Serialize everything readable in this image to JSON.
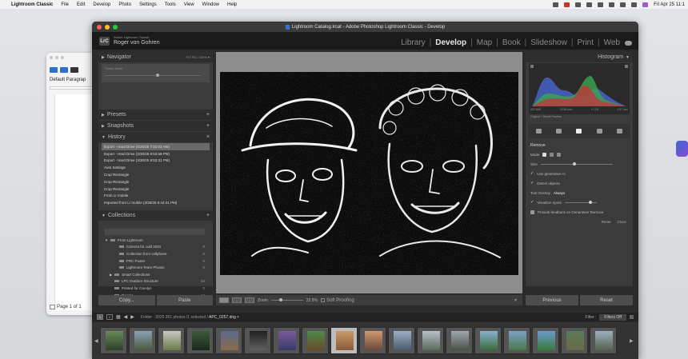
{
  "menubar": {
    "items": [
      "Lightroom Classic",
      "File",
      "Edit",
      "Develop",
      "Photo",
      "Settings",
      "Tools",
      "View",
      "Window",
      "Help"
    ],
    "clock": "Fri Apr 25 11:1"
  },
  "word": {
    "style": "Default Paragrap",
    "status": "Page 1 of 1"
  },
  "lr": {
    "title": "Lightroom Catalog.lrcat - Adobe Photoshop Lightroom Classic - Develop",
    "brand": "Adobe Lightroom Classic",
    "user": "Roger von Gohren",
    "modules": [
      "Library",
      "Develop",
      "Map",
      "Book",
      "Slideshow",
      "Print",
      "Web"
    ],
    "active_module": "Develop",
    "left": {
      "navigator": "Navigator",
      "nav_zoom": "FIT  FILL  100%  ▾",
      "nav_preset": "Preset  None",
      "presets": "Presets",
      "snapshots": "Snapshots",
      "history": "History",
      "history_items": [
        "Export - Hard Drive (4/25/25 7:52:03 AM)",
        "Export - Hard Drive (3/30/25 8:53:58 PM)",
        "Export - Hard Drive (3/30/25 8:53:31 PM)",
        "Auto Settings",
        "Crop Rectangle",
        "Crop Rectangle",
        "Crop Rectangle",
        "From Lr mobile",
        "Imported from Lr mobile (3/30/25 5:44:41 PM)"
      ],
      "collections": "Collections",
      "collection_items": [
        {
          "label": "From Lightroom",
          "count": ""
        },
        {
          "label": "Camera for cold 2021",
          "count": "0"
        },
        {
          "label": "Collection from cellphone",
          "count": "0"
        },
        {
          "label": "FRC Poster",
          "count": "0"
        },
        {
          "label": "Lightroom Team Photos",
          "count": "0"
        },
        {
          "label": "Smart Collections",
          "count": ""
        },
        {
          "label": "LPC Outdoor Structure",
          "count": "20"
        },
        {
          "label": "Printed for Carolyn",
          "count": "0"
        },
        {
          "label": "Rooms",
          "count": "44"
        }
      ],
      "copy_btn": "Copy...",
      "paste_btn": "Paste"
    },
    "toolbar": {
      "zoom": "Zoom",
      "zoom_val": "22.5%",
      "soft_proofing": "Soft Proofing"
    },
    "right": {
      "histogram": "Histogram",
      "meta": [
        "ISO 640",
        "15.66 mm",
        "f / 2.8",
        "1/17 sec"
      ],
      "preview": "Original + Smart Preview",
      "remove": "Remove",
      "mode": "Mode",
      "size": "Size",
      "use_gen_ai": "Use generative AI",
      "detect_objects": "Detect objects",
      "tool_overlay": "Tool Overlay",
      "always": "Always",
      "visualize": "Visualize Spots",
      "feedback": "Provide feedback on Generative Remove",
      "reset": "Reset",
      "close": "Close",
      "previous_btn": "Previous",
      "reset_btn": "Reset"
    },
    "filmbar": {
      "num1": "1",
      "num2": "2",
      "folder": "Folder : 2025",
      "count": "261 photos /1 selected /",
      "file": "APC_0257.dng",
      "filter_label": "Filter :",
      "filter_value": "Filters Off"
    }
  },
  "colors": {
    "histogram_red": "#c8333a",
    "histogram_green": "#3aa64c",
    "histogram_blue": "#4762c8",
    "accent_blue": "#3b6fd8"
  }
}
